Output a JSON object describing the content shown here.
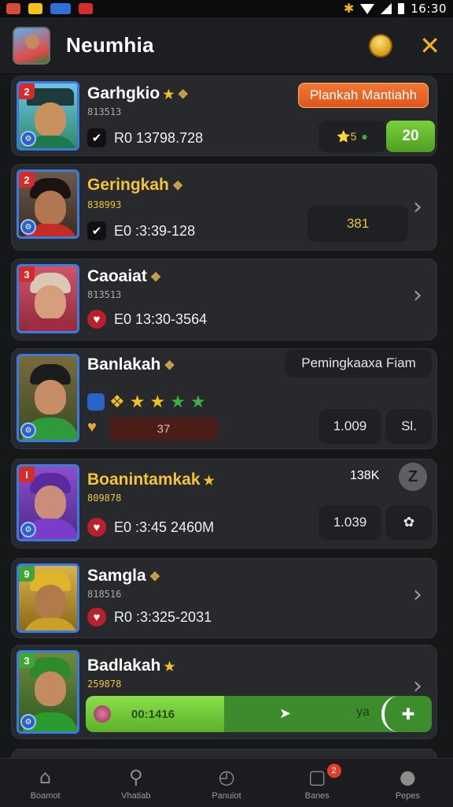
{
  "status_bar": {
    "time": "16:30"
  },
  "header": {
    "title": "Neumhia"
  },
  "rows": [
    {
      "rank": "2",
      "name": "Garhgkio",
      "sub": "813513",
      "stat": "R0 13798.728",
      "action_label": "Plankah Mantiahh",
      "mini_value": "⭐5",
      "count": "20"
    },
    {
      "rank": "2",
      "name": "Geringkah",
      "sub": "838993",
      "stat": "E0 :3:39-128",
      "value": "381"
    },
    {
      "rank": "3",
      "name": "Caoaiat",
      "sub": "813513",
      "stat": "E0 13:30-3564"
    },
    {
      "name": "Banlakah",
      "tagline": "Pemingkaaxa Fiam",
      "bar_value": "37",
      "value": "1.009",
      "side": "Sl."
    },
    {
      "rank": "I",
      "name": "Boanintamkak",
      "sub": "809878",
      "stat": "E0 :3:45 2460M",
      "score": "138K",
      "badge": "Z",
      "value": "1.039"
    },
    {
      "rank": "9",
      "name": "Samgla",
      "sub": "818516",
      "stat": "R0 :3:325-2031"
    },
    {
      "rank": "3",
      "name": "Badlakah",
      "sub": "259878",
      "progress_label": "00:1416",
      "progress_end": "ya",
      "progress_fraction": 0.4
    }
  ],
  "nav": [
    {
      "label": "Boamot",
      "icon": "home-icon"
    },
    {
      "label": "Vhatiab",
      "icon": "search-icon"
    },
    {
      "label": "Panuiot",
      "icon": "clock-icon"
    },
    {
      "label": "Banes",
      "icon": "chat-icon",
      "badge": "2"
    },
    {
      "label": "Pepes",
      "icon": "profile-icon"
    }
  ],
  "colors": {
    "accent": "#f0b221",
    "orange": "#e0561b",
    "green": "#5bb22a",
    "card": "#28292c"
  }
}
